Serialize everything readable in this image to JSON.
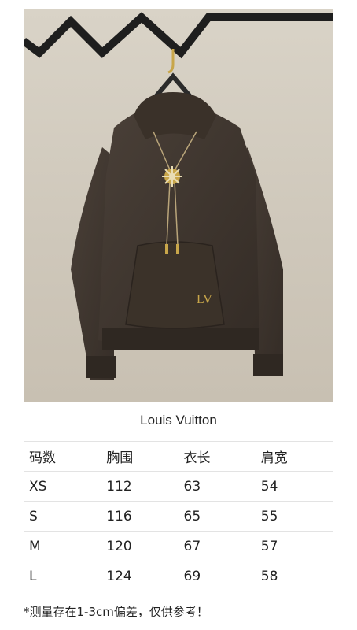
{
  "photo": {
    "product": "hoodie"
  },
  "brand": "Louis Vuitton",
  "size_table": {
    "headers": [
      "码数",
      "胸围",
      "衣长",
      "肩宽"
    ],
    "rows": [
      [
        "XS",
        "112",
        "63",
        "54"
      ],
      [
        "S",
        "116",
        "65",
        "55"
      ],
      [
        "M",
        "120",
        "67",
        "57"
      ],
      [
        "L",
        "124",
        "69",
        "58"
      ]
    ]
  },
  "note": "*测量存在1-3cm偏差，仅供参考！",
  "colors": {
    "hoodie": "#3e352e",
    "wall": "#d4cdc1",
    "rack": "#222222"
  }
}
